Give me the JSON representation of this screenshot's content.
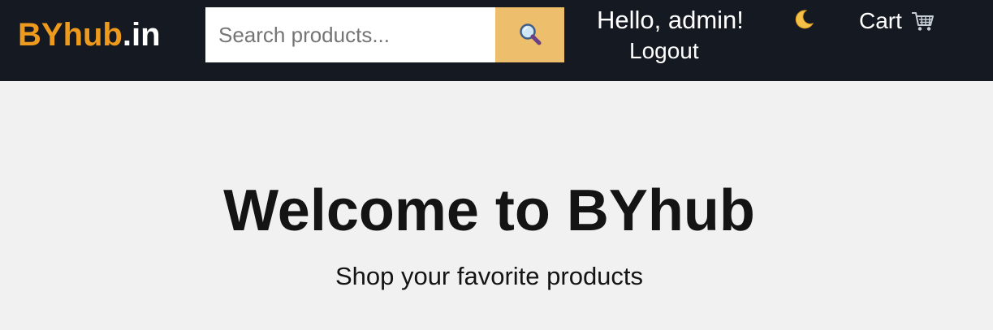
{
  "header": {
    "logo": {
      "brand": "BYhub",
      "tld": ".in"
    },
    "search": {
      "placeholder": "Search products...",
      "value": "",
      "button_icon": "magnifier-icon"
    },
    "user": {
      "greeting": "Hello, admin!",
      "logout_label": "Logout"
    },
    "theme_toggle": {
      "icon": "crescent-moon-icon"
    },
    "cart": {
      "label": "Cart",
      "icon": "shopping-cart-icon"
    }
  },
  "hero": {
    "title": "Welcome to BYhub",
    "subtitle": "Shop your favorite products"
  },
  "colors": {
    "navbar_bg": "#151922",
    "brand_accent": "#ee9b1d",
    "search_button_bg": "#edbe6c",
    "page_bg": "#f1f1f1",
    "text_dark": "#141414"
  }
}
